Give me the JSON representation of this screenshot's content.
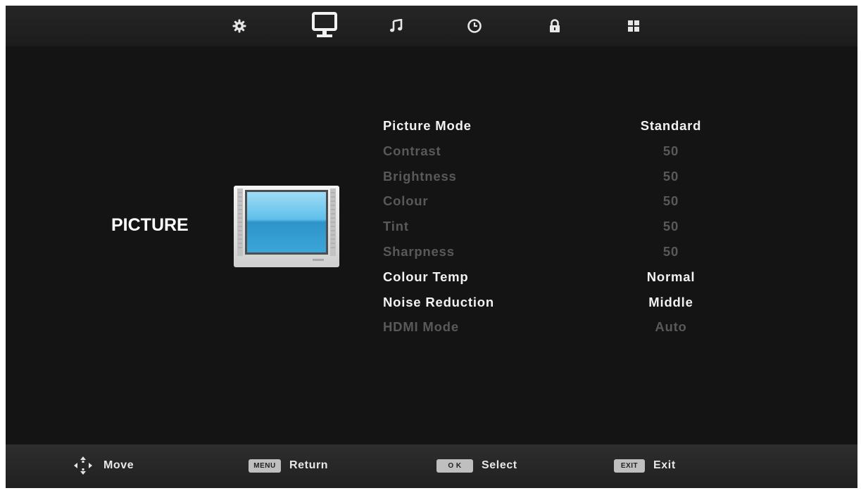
{
  "colors": {
    "background": "#141414",
    "text_enabled": "#f2f2f2",
    "text_disabled": "#595959",
    "screen_blue": "#3da6d8"
  },
  "tabs": [
    {
      "icon": "gear-icon",
      "active": false
    },
    {
      "icon": "monitor-icon",
      "active": true
    },
    {
      "icon": "music-note-icon",
      "active": false
    },
    {
      "icon": "clock-icon",
      "active": false
    },
    {
      "icon": "lock-icon",
      "active": false
    },
    {
      "icon": "grid-icon",
      "active": false
    }
  ],
  "section": {
    "title": "PICTURE",
    "icon": "tv-picture-icon"
  },
  "menu": [
    {
      "label": "Picture Mode",
      "value": "Standard",
      "enabled": true
    },
    {
      "label": "Contrast",
      "value": "50",
      "enabled": false
    },
    {
      "label": "Brightness",
      "value": "50",
      "enabled": false
    },
    {
      "label": "Colour",
      "value": "50",
      "enabled": false
    },
    {
      "label": "Tint",
      "value": "50",
      "enabled": false
    },
    {
      "label": "Sharpness",
      "value": "50",
      "enabled": false
    },
    {
      "label": "Colour Temp",
      "value": "Normal",
      "enabled": true
    },
    {
      "label": "Noise Reduction",
      "value": "Middle",
      "enabled": true
    },
    {
      "label": "HDMI Mode",
      "value": "Auto",
      "enabled": false
    }
  ],
  "footer": {
    "move": {
      "icon": "arrows-icon",
      "label": "Move"
    },
    "return": {
      "key": "MENU",
      "label": "Return"
    },
    "select": {
      "key": "O K",
      "label": "Select"
    },
    "exit": {
      "key": "EXIT",
      "label": "Exit"
    }
  }
}
